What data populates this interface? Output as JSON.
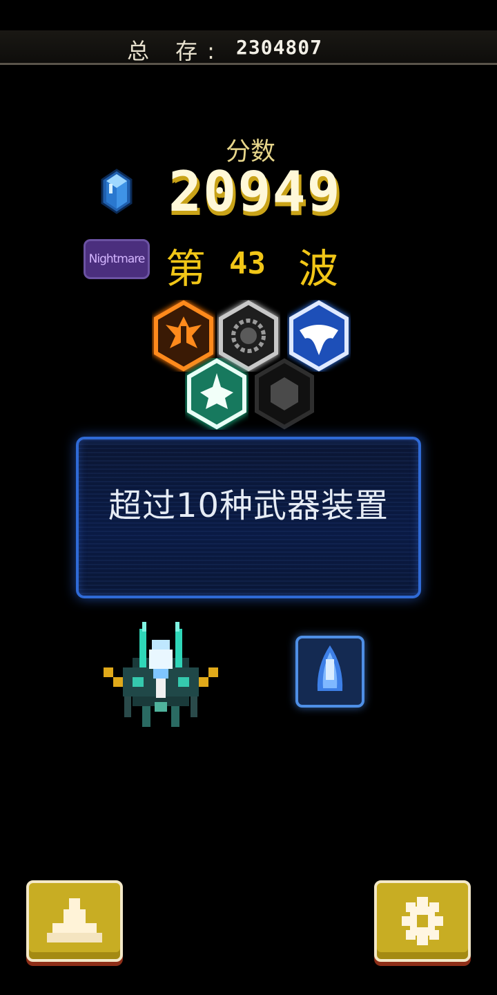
{
  "header": {
    "total_label": "总 存:",
    "total_value": "2304807"
  },
  "score": {
    "label": "分数",
    "value": "20949",
    "gem_icon": "blue-crystal-icon"
  },
  "difficulty": {
    "label": "Nightmare",
    "color": "#4b2f7e"
  },
  "wave": {
    "prefix": "第",
    "number": "43",
    "suffix": "波"
  },
  "badges": [
    {
      "icon": "phoenix-emblem-icon",
      "color": "#ff8a1c"
    },
    {
      "icon": "laurel-wreath-icon",
      "color": "#bdbdbd"
    },
    {
      "icon": "manta-ray-icon",
      "color": "#2f6fe0"
    },
    {
      "icon": "fighter-jet-emblem-icon",
      "color": "#2fd6a6"
    },
    {
      "icon": "locked-hex-icon",
      "color": "#4a4a4a"
    }
  ],
  "message": {
    "text": "超过10种武器装置"
  },
  "ship": {
    "icon": "spaceship-icon"
  },
  "upgrade": {
    "icon": "blue-thruster-icon"
  },
  "buttons": {
    "hangar_icon": "ship-silhouette-icon",
    "settings_icon": "gear-icon"
  },
  "colors": {
    "score_gold": "#c9a318",
    "wave_yellow": "#f1c617",
    "panel_blue": "#2f6ad6",
    "button_gold": "#c8ad23"
  }
}
